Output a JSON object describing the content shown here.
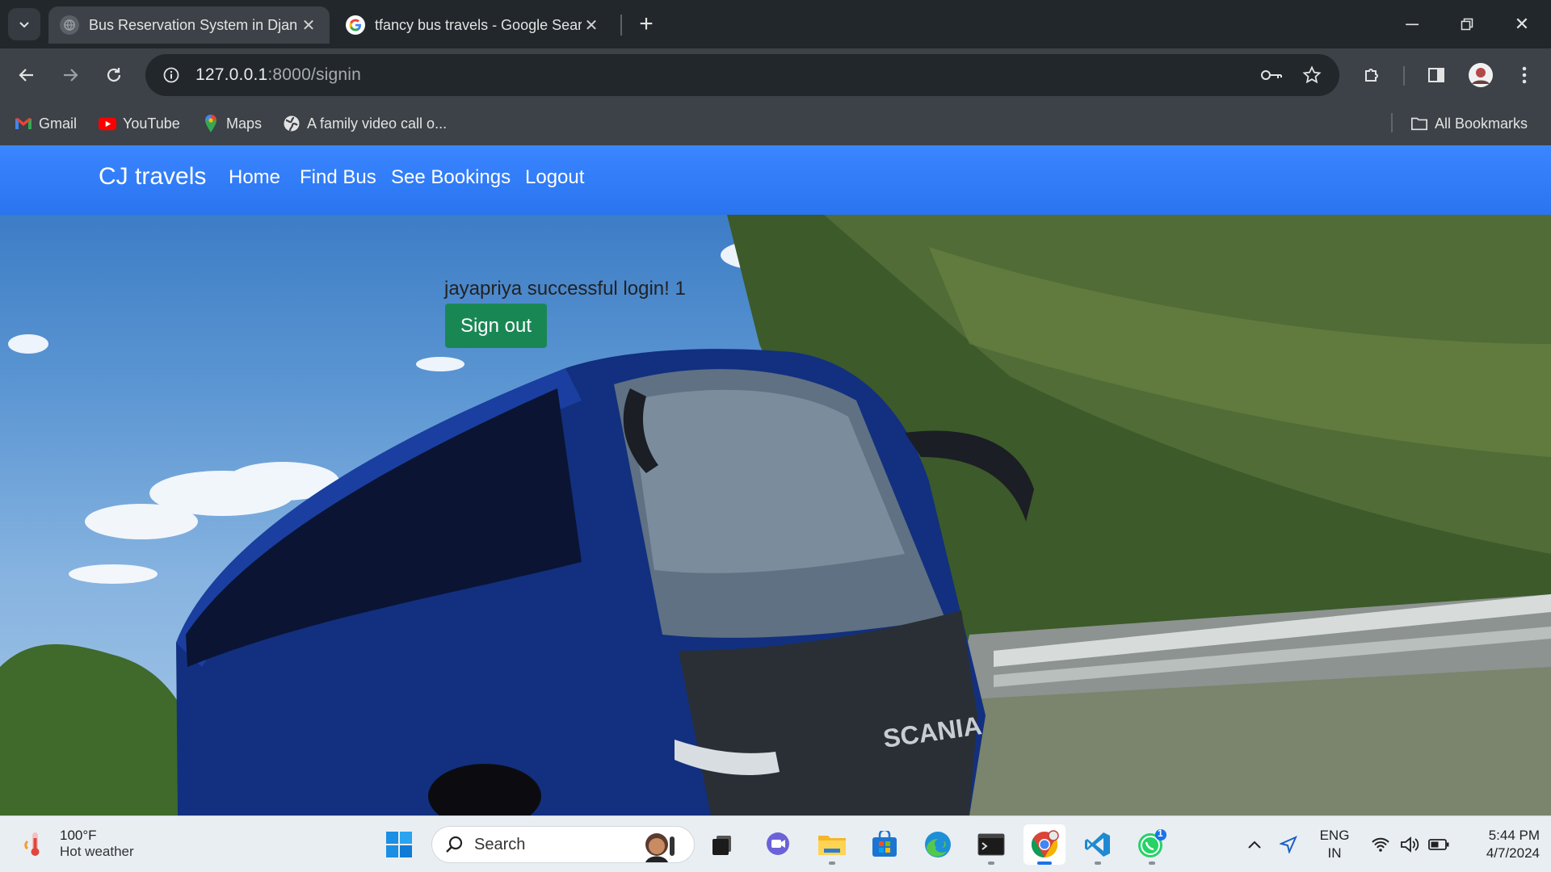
{
  "browser": {
    "tabs": [
      {
        "title": "Bus Reservation System in Djan",
        "active": true
      },
      {
        "title": "tfancy bus travels - Google Sear",
        "active": false
      }
    ],
    "address": {
      "host": "127.0.0.1",
      "rest": ":8000/signin"
    },
    "bookmarks": [
      {
        "label": "Gmail",
        "icon": "gmail-icon"
      },
      {
        "label": "YouTube",
        "icon": "youtube-icon"
      },
      {
        "label": "Maps",
        "icon": "maps-icon"
      },
      {
        "label": "A family video call o...",
        "icon": "globe-icon"
      }
    ],
    "all_bookmarks": "All Bookmarks"
  },
  "site": {
    "brand": "CJ travels",
    "nav": [
      "Home",
      "Find Bus",
      "See Bookings",
      "Logout"
    ],
    "message": "jayapriya successful login! 1",
    "signout_label": "Sign out",
    "nav_color": "#2f7bf5",
    "button_color": "#198754"
  },
  "taskbar": {
    "weather": {
      "temp": "100°F",
      "desc": "Hot weather"
    },
    "search_placeholder": "Search",
    "tray": {
      "lang1": "ENG",
      "lang2": "IN",
      "time": "5:44 PM",
      "date": "4/7/2024"
    },
    "whatsapp_badge": "1"
  }
}
